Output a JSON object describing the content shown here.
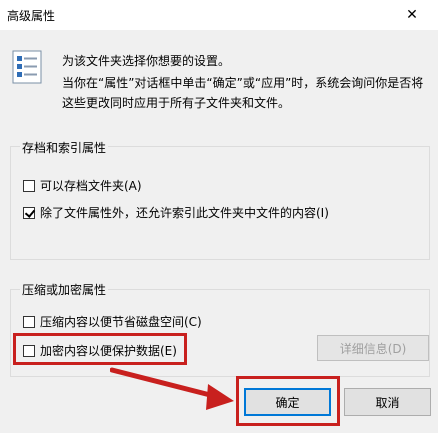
{
  "window": {
    "title": "高级属性",
    "close_glyph": "✕"
  },
  "description": {
    "line1": "为该文件夹选择你想要的设置。",
    "line2": "当你在“属性”对话框中单击“确定”或“应用”时，系统会询问你是否将这些更改同时应用于所有子文件夹和文件。"
  },
  "archive_group": {
    "label": "存档和索引属性",
    "items": [
      {
        "label": "可以存档文件夹(A)",
        "checked": false
      },
      {
        "label": "除了文件属性外，还允许索引此文件夹中文件的内容(I)",
        "checked": true
      }
    ]
  },
  "compress_group": {
    "label": "压缩或加密属性",
    "items": [
      {
        "label": "压缩内容以便节省磁盘空间(C)",
        "checked": false
      },
      {
        "label": "加密内容以便保护数据(E)",
        "checked": false
      }
    ],
    "details_button": "详细信息(D)"
  },
  "buttons": {
    "ok": "确定",
    "cancel": "取消"
  },
  "colors": {
    "highlight": "#c8201e",
    "focus": "#0078d7"
  }
}
